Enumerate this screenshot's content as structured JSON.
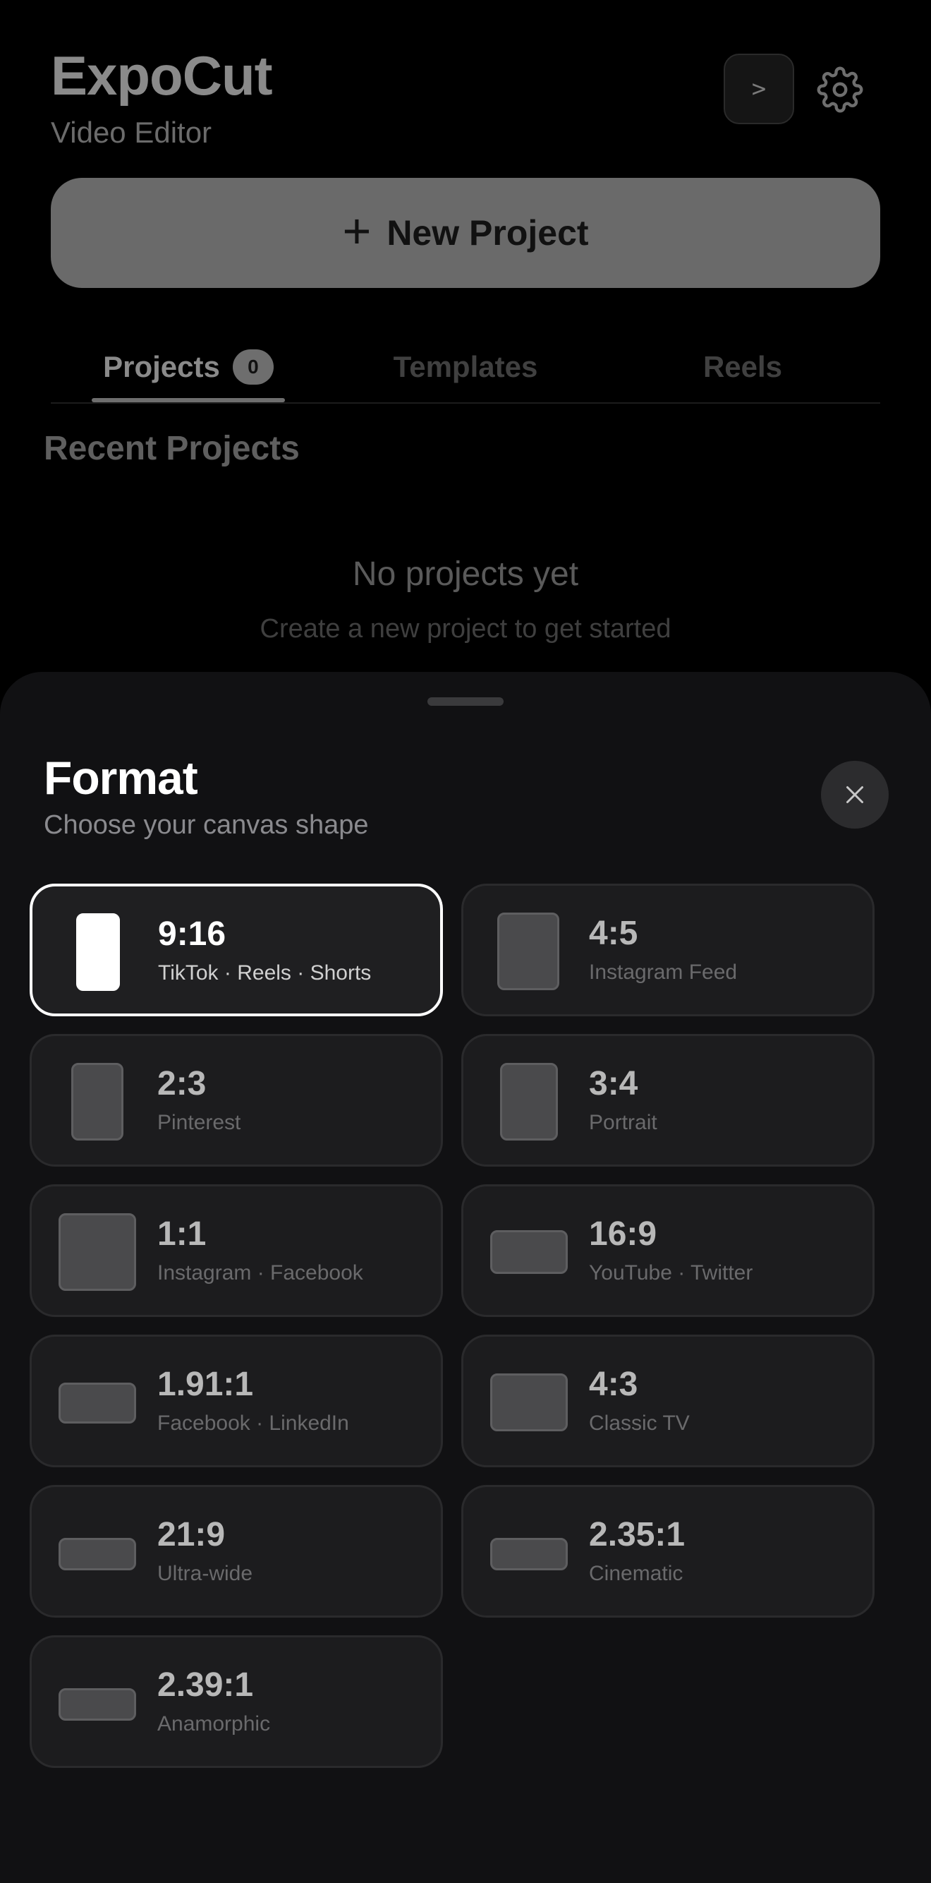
{
  "app": {
    "title": "ExpoCut",
    "subtitle": "Video Editor",
    "terminal_label": ">",
    "new_project_label": "New Project"
  },
  "tabs": [
    {
      "label": "Projects",
      "count": "0",
      "active": true
    },
    {
      "label": "Templates",
      "active": false
    },
    {
      "label": "Reels",
      "active": false
    }
  ],
  "recent": {
    "heading": "Recent Projects",
    "empty_title": "No projects yet",
    "empty_subtitle": "Create a new project to get started"
  },
  "sheet": {
    "title": "Format",
    "subtitle": "Choose your canvas shape",
    "formats": [
      {
        "ratio": "9:16",
        "desc": "TikTok · Reels · Shorts",
        "selected": true
      },
      {
        "ratio": "4:5",
        "desc": "Instagram Feed",
        "selected": false
      },
      {
        "ratio": "2:3",
        "desc": "Pinterest",
        "selected": false
      },
      {
        "ratio": "3:4",
        "desc": "Portrait",
        "selected": false
      },
      {
        "ratio": "1:1",
        "desc": "Instagram · Facebook",
        "selected": false
      },
      {
        "ratio": "16:9",
        "desc": "YouTube · Twitter",
        "selected": false
      },
      {
        "ratio": "1.91:1",
        "desc": "Facebook · LinkedIn",
        "selected": false
      },
      {
        "ratio": "4:3",
        "desc": "Classic TV",
        "selected": false
      },
      {
        "ratio": "21:9",
        "desc": "Ultra-wide",
        "selected": false
      },
      {
        "ratio": "2.35:1",
        "desc": "Cinematic",
        "selected": false
      },
      {
        "ratio": "2.39:1",
        "desc": "Anamorphic",
        "selected": false
      }
    ]
  },
  "icons": {
    "settings": "gear-icon",
    "new_project": "plus-icon",
    "close": "close-icon"
  }
}
